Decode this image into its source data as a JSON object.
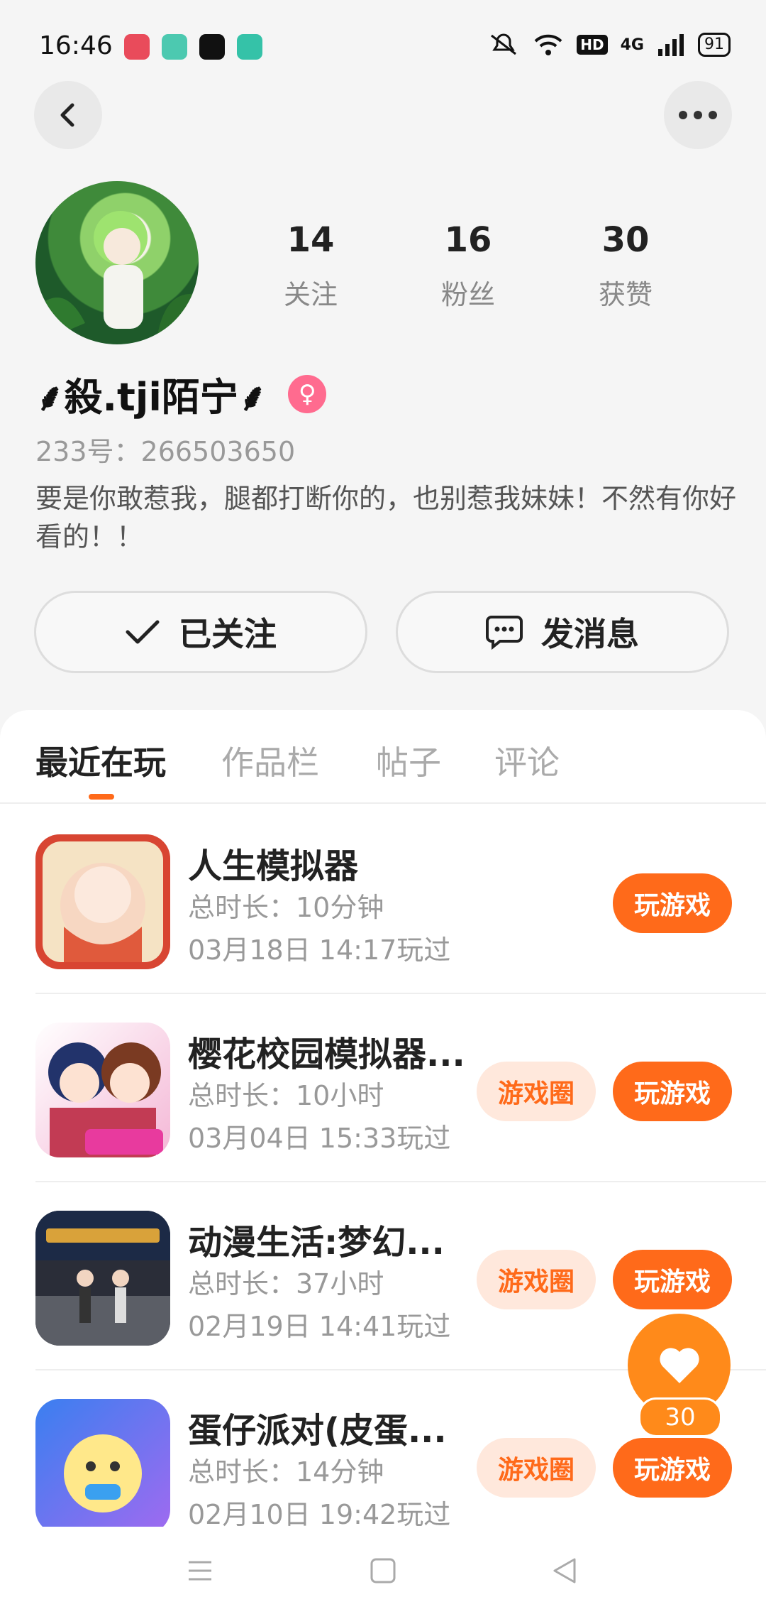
{
  "status_bar": {
    "time": "16:46",
    "hd": "HD",
    "net": "4G",
    "battery": "91"
  },
  "profile": {
    "stats": [
      {
        "num": "14",
        "label": "关注"
      },
      {
        "num": "16",
        "label": "粉丝"
      },
      {
        "num": "30",
        "label": "获赞"
      }
    ],
    "username": "⸙殺.tji陌宁⸙",
    "gender_symbol": "♀",
    "user_id": "233号：266503650",
    "bio": "要是你敢惹我，腿都打断你的，也别惹我妹妹！不然有你好看的！！",
    "follow_label": "已关注",
    "message_label": "发消息"
  },
  "tabs": [
    "最近在玩",
    "作品栏",
    "帖子",
    "评论"
  ],
  "games": [
    {
      "name": "人生模拟器",
      "duration": "总时长：10分钟",
      "last": "03月18日 14:17玩过",
      "circle": "",
      "play": "玩游戏"
    },
    {
      "name": "樱花校园模拟器...",
      "duration": "总时长：10小时",
      "last": "03月04日 15:33玩过",
      "circle": "游戏圈",
      "play": "玩游戏"
    },
    {
      "name": "动漫生活:梦幻...",
      "duration": "总时长：37小时",
      "last": "02月19日 14:41玩过",
      "circle": "游戏圈",
      "play": "玩游戏"
    },
    {
      "name": "蛋仔派对(皮蛋...",
      "duration": "总时长：14分钟",
      "last": "02月10日 19:42玩过",
      "circle": "游戏圈",
      "play": "玩游戏"
    }
  ],
  "like_fab": {
    "count": "30"
  },
  "colors": {
    "accent": "#ff6a1a",
    "fab": "#ff8a1a",
    "pink": "#ff6b8f"
  }
}
